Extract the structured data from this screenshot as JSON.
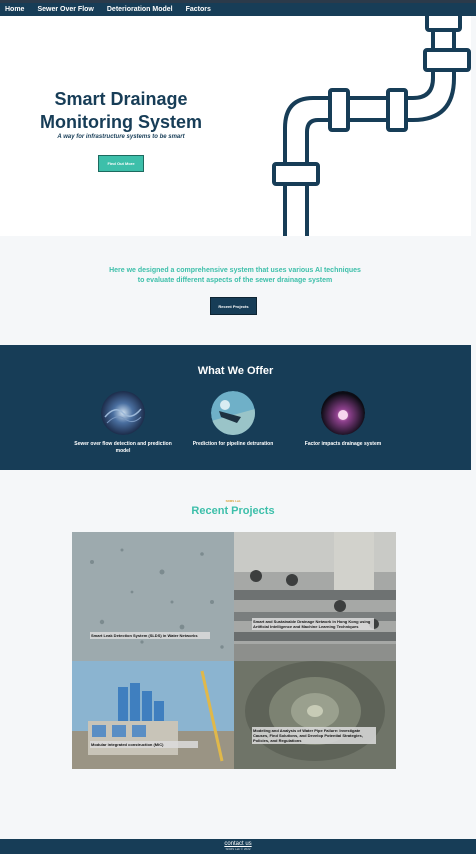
{
  "nav": {
    "items": [
      {
        "label": "Home"
      },
      {
        "label": "Sewer Over Flow"
      },
      {
        "label": "Deterioration Model"
      },
      {
        "label": "Factors"
      }
    ]
  },
  "hero": {
    "title_line1": "Smart Drainage",
    "title_line2": "Monitoring System",
    "subtitle": "A way for infrastructure systems to be smart",
    "button_label": "Find Out More"
  },
  "intro": {
    "line1": "Here we designed a comprehensive system that uses various AI techniques",
    "line2": "to evaluate different aspects of the sewer drainage system",
    "button_label": "Recent Projects"
  },
  "offer": {
    "title": "What We Offer",
    "items": [
      {
        "label": "Sewer over flow detection and prediction model"
      },
      {
        "label": "Prediction for pipeline detruration"
      },
      {
        "label": "Factor impacts drainage system"
      }
    ]
  },
  "projects": {
    "tag": "SDMS Lab",
    "title": "Recent Projects",
    "items": [
      {
        "label": "Smart Leak Detection System (SLDS) in Water Networks"
      },
      {
        "label": "Smart and Sustainable Drainage Network in Hong Kong using Artificial Intelligence and Machine Learning Techniques"
      },
      {
        "label": "Modular integrated construction (MiC)"
      },
      {
        "label": "Modeling and Analysis of Water Pipe Failure: Investigate Causes, Find Solutions, and Develop Potential Strategies, Policies, and Regulations"
      }
    ]
  },
  "footer": {
    "link": "contact us",
    "copyright": "SDMS Lab © 2022"
  },
  "colors": {
    "primary": "#173d57",
    "accent": "#3dbfaa",
    "tag": "#d9a441"
  },
  "icons": {
    "hero_graphic": "pipe-illustration"
  }
}
